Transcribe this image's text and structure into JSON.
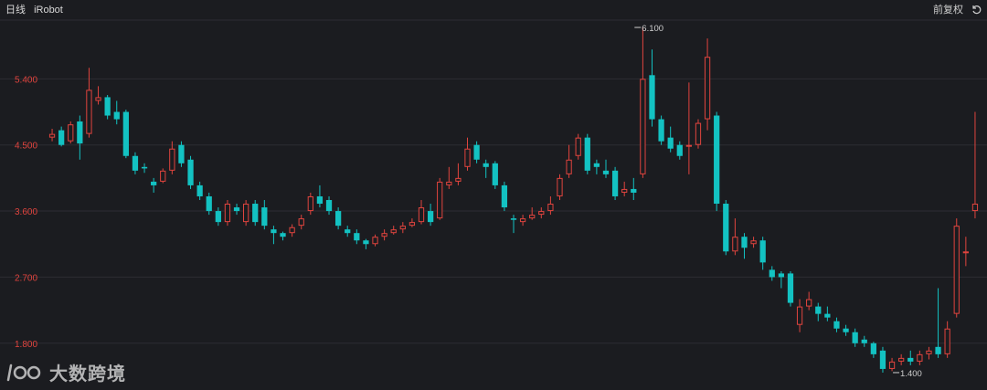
{
  "header": {
    "period": "日线",
    "symbol": "iRobot",
    "adjust": "前复权"
  },
  "watermark": {
    "text": "大数跨境"
  },
  "colors": {
    "up": "#e0443e",
    "down": "#13c2c2",
    "grid": "#2c2d33",
    "label": "#e0443e",
    "bg": "#1b1c20"
  },
  "chart_data": {
    "type": "candlestick",
    "title": "",
    "ylim": [
      1.3,
      6.2
    ],
    "yticks": [
      1.8,
      2.7,
      3.6,
      4.5,
      5.4
    ],
    "ytick_labels": [
      "1.800",
      "2.700",
      "3.600",
      "4.500",
      "5.400"
    ],
    "annotations": [
      {
        "text": "6.100",
        "index": 63,
        "value": 6.1
      },
      {
        "text": "1.400",
        "index": 91,
        "value": 1.4
      }
    ],
    "candles": [
      [
        4.6,
        4.65,
        4.72,
        4.55
      ],
      [
        4.7,
        4.5,
        4.75,
        4.48
      ],
      [
        4.55,
        4.78,
        4.82,
        4.52
      ],
      [
        4.82,
        4.52,
        4.9,
        4.3
      ],
      [
        4.65,
        5.25,
        5.55,
        4.6
      ],
      [
        5.1,
        5.15,
        5.3,
        5.05
      ],
      [
        5.15,
        4.9,
        5.18,
        4.85
      ],
      [
        4.95,
        4.85,
        5.1,
        4.78
      ],
      [
        4.95,
        4.35,
        4.98,
        4.32
      ],
      [
        4.35,
        4.15,
        4.4,
        4.1
      ],
      [
        4.2,
        4.18,
        4.25,
        4.12
      ],
      [
        4.0,
        3.95,
        4.05,
        3.85
      ],
      [
        4.0,
        4.15,
        4.18,
        3.98
      ],
      [
        4.15,
        4.45,
        4.55,
        4.1
      ],
      [
        4.5,
        4.25,
        4.55,
        4.2
      ],
      [
        4.3,
        3.95,
        4.35,
        3.9
      ],
      [
        3.95,
        3.8,
        4.0,
        3.75
      ],
      [
        3.8,
        3.6,
        3.85,
        3.55
      ],
      [
        3.6,
        3.45,
        3.65,
        3.4
      ],
      [
        3.45,
        3.7,
        3.75,
        3.4
      ],
      [
        3.65,
        3.6,
        3.7,
        3.55
      ],
      [
        3.45,
        3.7,
        3.75,
        3.4
      ],
      [
        3.7,
        3.45,
        3.75,
        3.4
      ],
      [
        3.65,
        3.4,
        3.75,
        3.35
      ],
      [
        3.35,
        3.3,
        3.4,
        3.15
      ],
      [
        3.3,
        3.25,
        3.32,
        3.2
      ],
      [
        3.3,
        3.38,
        3.42,
        3.25
      ],
      [
        3.4,
        3.5,
        3.55,
        3.35
      ],
      [
        3.6,
        3.8,
        3.85,
        3.55
      ],
      [
        3.8,
        3.7,
        3.95,
        3.65
      ],
      [
        3.75,
        3.6,
        3.8,
        3.55
      ],
      [
        3.6,
        3.4,
        3.65,
        3.35
      ],
      [
        3.35,
        3.3,
        3.4,
        3.25
      ],
      [
        3.3,
        3.2,
        3.35,
        3.15
      ],
      [
        3.2,
        3.15,
        3.22,
        3.08
      ],
      [
        3.15,
        3.25,
        3.28,
        3.12
      ],
      [
        3.25,
        3.3,
        3.35,
        3.2
      ],
      [
        3.3,
        3.35,
        3.4,
        3.28
      ],
      [
        3.35,
        3.4,
        3.45,
        3.3
      ],
      [
        3.4,
        3.45,
        3.5,
        3.38
      ],
      [
        3.45,
        3.65,
        3.75,
        3.42
      ],
      [
        3.6,
        3.45,
        3.7,
        3.4
      ],
      [
        3.5,
        4.0,
        4.05,
        3.48
      ],
      [
        3.95,
        4.0,
        4.2,
        3.9
      ],
      [
        4.0,
        4.05,
        4.25,
        3.95
      ],
      [
        4.2,
        4.45,
        4.6,
        4.15
      ],
      [
        4.5,
        4.3,
        4.55,
        4.25
      ],
      [
        4.25,
        4.2,
        4.3,
        4.05
      ],
      [
        4.25,
        3.95,
        4.28,
        3.9
      ],
      [
        3.95,
        3.65,
        4.0,
        3.6
      ],
      [
        3.5,
        3.48,
        3.55,
        3.3
      ],
      [
        3.45,
        3.5,
        3.55,
        3.4
      ],
      [
        3.5,
        3.55,
        3.65,
        3.48
      ],
      [
        3.55,
        3.6,
        3.65,
        3.5
      ],
      [
        3.6,
        3.7,
        3.8,
        3.55
      ],
      [
        3.8,
        4.05,
        4.1,
        3.75
      ],
      [
        4.1,
        4.3,
        4.5,
        4.05
      ],
      [
        4.35,
        4.6,
        4.65,
        4.3
      ],
      [
        4.6,
        4.15,
        4.65,
        4.1
      ],
      [
        4.25,
        4.2,
        4.3,
        4.1
      ],
      [
        4.15,
        4.1,
        4.3,
        4.05
      ],
      [
        4.15,
        3.8,
        4.2,
        3.75
      ],
      [
        3.85,
        3.9,
        4.0,
        3.8
      ],
      [
        3.9,
        3.85,
        4.05,
        3.75
      ],
      [
        4.1,
        5.4,
        6.1,
        4.05
      ],
      [
        5.45,
        4.85,
        5.8,
        4.75
      ],
      [
        4.85,
        4.55,
        4.9,
        4.5
      ],
      [
        4.6,
        4.45,
        4.75,
        4.4
      ],
      [
        4.5,
        4.35,
        4.55,
        4.3
      ],
      [
        4.5,
        4.5,
        5.35,
        4.1
      ],
      [
        4.5,
        4.8,
        4.85,
        4.45
      ],
      [
        4.85,
        5.7,
        5.95,
        4.7
      ],
      [
        4.9,
        3.7,
        4.95,
        3.6
      ],
      [
        3.7,
        3.05,
        3.75,
        3.0
      ],
      [
        3.05,
        3.25,
        3.5,
        3.0
      ],
      [
        3.25,
        3.1,
        3.3,
        2.95
      ],
      [
        3.15,
        3.2,
        3.25,
        3.1
      ],
      [
        3.2,
        2.9,
        3.25,
        2.8
      ],
      [
        2.8,
        2.7,
        2.85,
        2.65
      ],
      [
        2.75,
        2.7,
        2.78,
        2.55
      ],
      [
        2.75,
        2.35,
        2.78,
        2.3
      ],
      [
        2.05,
        2.3,
        2.4,
        1.95
      ],
      [
        2.3,
        2.4,
        2.5,
        2.25
      ],
      [
        2.3,
        2.2,
        2.35,
        2.1
      ],
      [
        2.2,
        2.15,
        2.3,
        2.1
      ],
      [
        2.1,
        2.0,
        2.15,
        1.95
      ],
      [
        2.0,
        1.95,
        2.05,
        1.9
      ],
      [
        1.95,
        1.8,
        2.0,
        1.75
      ],
      [
        1.85,
        1.8,
        1.9,
        1.75
      ],
      [
        1.8,
        1.65,
        1.82,
        1.6
      ],
      [
        1.7,
        1.45,
        1.75,
        1.4
      ],
      [
        1.45,
        1.55,
        1.6,
        1.42
      ],
      [
        1.55,
        1.6,
        1.65,
        1.5
      ],
      [
        1.6,
        1.55,
        1.7,
        1.5
      ],
      [
        1.55,
        1.65,
        1.7,
        1.5
      ],
      [
        1.65,
        1.7,
        1.75,
        1.58
      ],
      [
        1.75,
        1.65,
        2.55,
        1.6
      ],
      [
        1.65,
        2.0,
        2.1,
        1.6
      ],
      [
        2.2,
        3.4,
        3.5,
        2.15
      ],
      [
        3.05,
        3.05,
        3.25,
        2.85
      ],
      [
        3.6,
        3.7,
        4.95,
        3.5
      ]
    ]
  }
}
